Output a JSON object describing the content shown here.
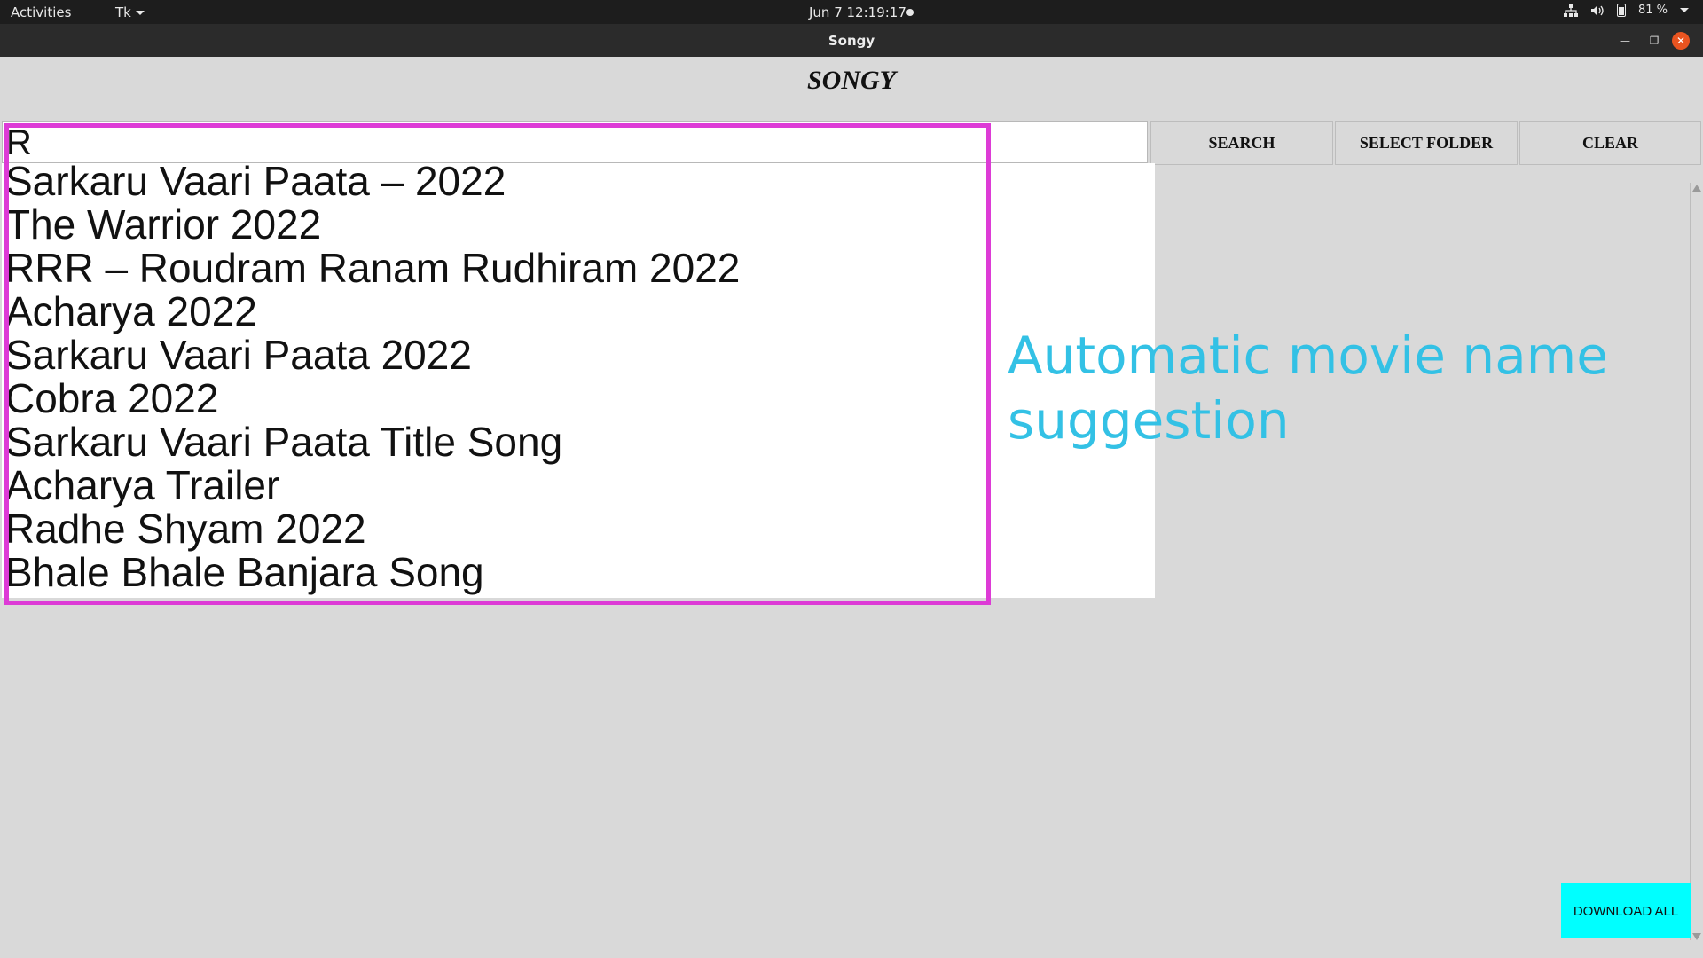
{
  "topbar": {
    "activities": "Activities",
    "app_menu": "Tk",
    "clock": "Jun 7  12:19:17",
    "battery": "81 %",
    "icons": [
      "network-icon",
      "volume-icon",
      "battery-icon"
    ]
  },
  "window": {
    "title": "Songy",
    "close_color": "#e95420"
  },
  "app": {
    "heading": "SONGY",
    "search_value": "R",
    "buttons": {
      "search": "SEARCH",
      "select_folder": "SELECT FOLDER",
      "clear": "CLEAR",
      "download_all": "DOWNLOAD ALL"
    },
    "suggestions": [
      "Sarkaru Vaari Paata – 2022",
      "The Warrior 2022",
      "RRR – Roudram Ranam Rudhiram 2022",
      "Acharya 2022",
      "Sarkaru Vaari Paata 2022",
      "Cobra 2022",
      "Sarkaru Vaari Paata Title Song",
      "Acharya Trailer",
      "Radhe Shyam 2022",
      "Bhale Bhale Banjara Song"
    ]
  },
  "annotation": {
    "text": "Automatic movie name suggestion",
    "box_color": "#dd3bd6",
    "text_color": "#33c1e5"
  },
  "colors": {
    "download_button": "#00ffff",
    "window_background": "#d9d9d9"
  }
}
